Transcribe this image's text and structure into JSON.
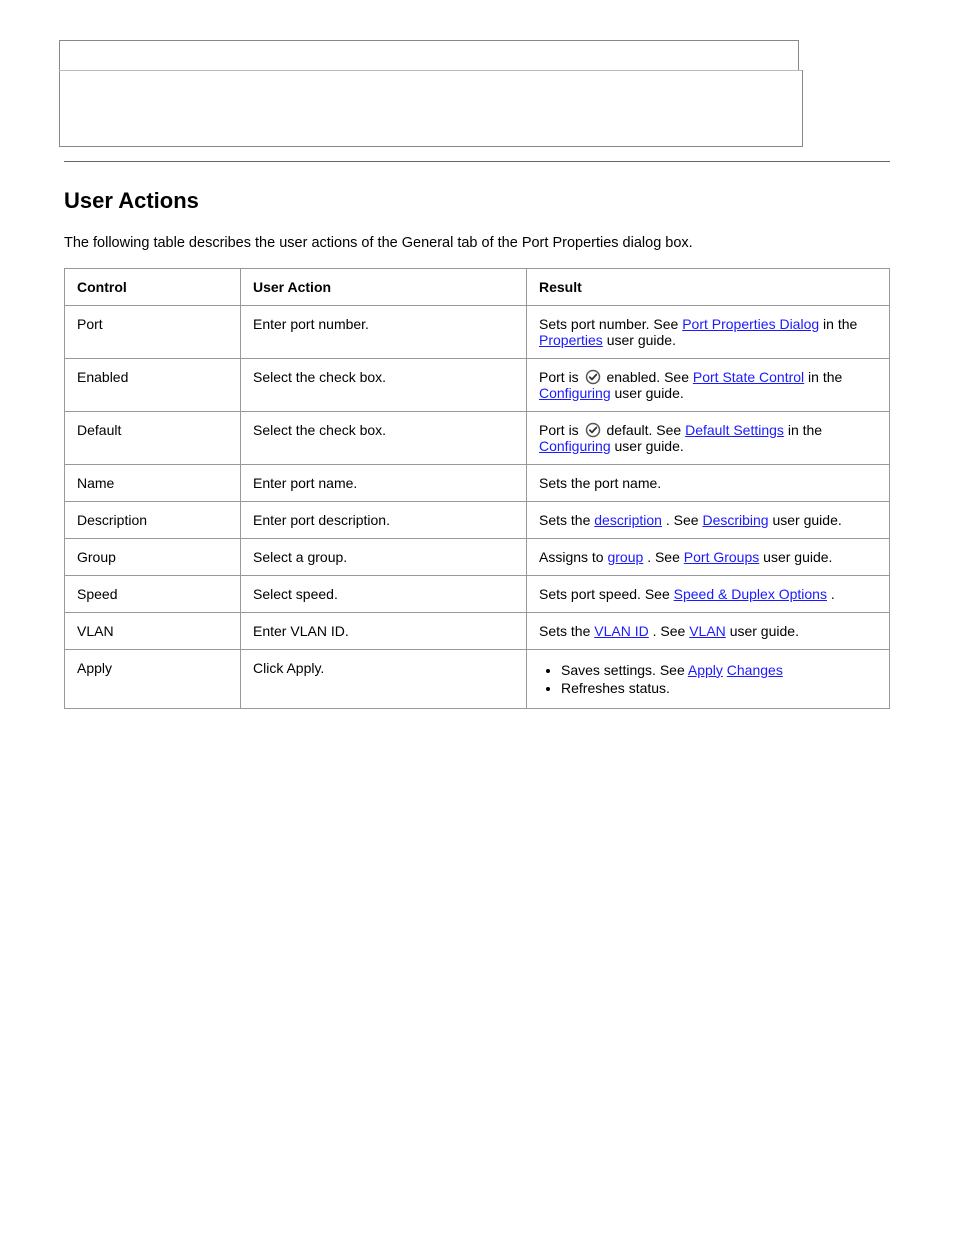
{
  "section": {
    "heading": "User Actions",
    "intro": "The following table describes the user actions of the General tab of the Port Properties dialog box."
  },
  "table": {
    "headers": {
      "c1": "Control",
      "c2": "User Action",
      "c3": "Result"
    },
    "rows": [
      {
        "control": "Port",
        "action": "Enter port number.",
        "plain1": "Sets port number. See ",
        "link1": "Port Properties Dialog",
        "plain2": " in the ",
        "link2": "Properties",
        "plain3": " user guide."
      },
      {
        "control": "Enabled",
        "action": "Select the check box.",
        "plain1": "Port is ",
        "iconThen": "enabled. See ",
        "link1": "Port State Control",
        "plain2": " in the ",
        "link2": "Configuring",
        "plain3": " user guide."
      },
      {
        "control": "Default",
        "action": "Select the check box.",
        "plain1": "Port is ",
        "iconThen": "default. See ",
        "link1": "Default Settings",
        "plain2": " in the ",
        "link2": "Configuring",
        "plain3": " user guide."
      },
      {
        "control": "Name",
        "action": "Enter port name.",
        "plain1": "Sets the port name."
      },
      {
        "control": "Description",
        "action": "Enter port description.",
        "plain1": "Sets the ",
        "link1": "description",
        "plain2": ". See ",
        "link2": "Describing",
        "plain3": " user guide."
      },
      {
        "control": "Group",
        "action": "Select a group.",
        "plain1": "Assigns to ",
        "link1": "group",
        "plain2": ". See ",
        "link2": "Port Groups",
        "plain3": " user guide."
      },
      {
        "control": "Speed",
        "action": "Select speed.",
        "plain1": "Sets port speed. See ",
        "link1": "Speed & Duplex Options",
        "plain2": "."
      },
      {
        "control": "VLAN",
        "action": "Enter VLAN ID.",
        "plain1": "Sets the ",
        "link1": "VLAN ID",
        "plain2": ". See ",
        "link2": "VLAN",
        "plain3": " user guide."
      },
      {
        "control": "Apply",
        "action": "Click Apply.",
        "bullets": [
          {
            "plain1": "Saves settings. See ",
            "link1": "Apply",
            "link2": "Changes"
          },
          {
            "plain1": "Refreshes status."
          }
        ]
      }
    ]
  }
}
